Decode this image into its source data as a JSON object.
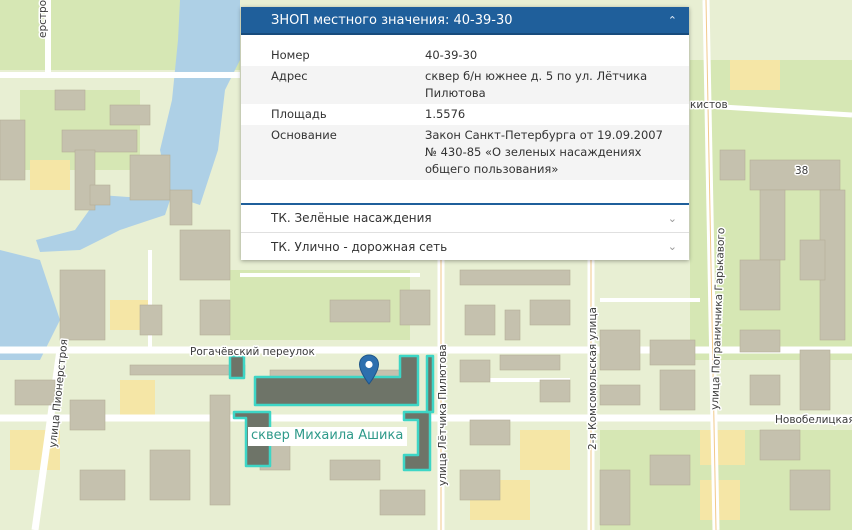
{
  "panel": {
    "header_title": "ЗНОП местного значения: 40-39-30",
    "rows": [
      {
        "key": "Номер",
        "value": "40-39-30"
      },
      {
        "key": "Адрес",
        "value": "сквер б/н южнее д. 5 по ул. Лётчика Пилютова"
      },
      {
        "key": "Площадь",
        "value": "1.5576"
      },
      {
        "key": "Основание",
        "value": "Закон Санкт-Петербурга от 19.09.2007 № 430-85 «О зеленых насаждениях общего пользования»"
      }
    ],
    "accordions": [
      {
        "label": "ТК. Зелёные насаждения"
      },
      {
        "label": "ТК. Улично - дорожная сеть"
      }
    ]
  },
  "map": {
    "park_label": "сквер Михаила Ашика",
    "streets": {
      "pionerskaya": "улица Пионерстроя",
      "rogachevsky": "Рогачёвский переулок",
      "pilyutova": "улица Лётчика Пилютова",
      "komsomolskaya": "2-я Комсомольская улица",
      "garkavogo": "улица Пограничника Гарькавого",
      "novobelitskaya": "Новобелицкая",
      "kistov": "кистов",
      "top_left": "ерстрой"
    },
    "house_number": "38",
    "colors": {
      "background": "#e8efd3",
      "water": "#aed0e6",
      "building": "#c5c1ae",
      "yellow_block": "#f5e6a6",
      "road": "#ffffff",
      "park_fill": "#6e7468",
      "park_stroke": "#3dd6c6",
      "header": "#1f5f9b",
      "pin": "#2d6fae"
    }
  }
}
